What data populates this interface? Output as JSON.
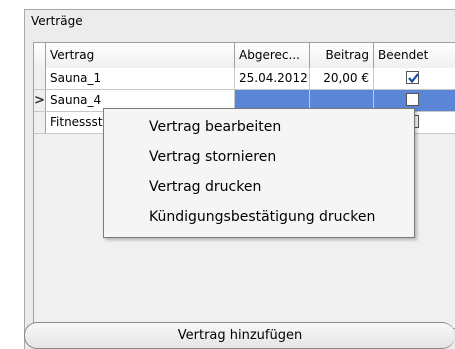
{
  "group": {
    "title": "Verträge"
  },
  "grid": {
    "columns": [
      "Vertrag",
      "Abgerec...",
      "Beitrag",
      "Beendet"
    ],
    "current_row_marker": ">",
    "rows": [
      {
        "vertrag": "Sauna_1",
        "abgerechnet": "25.04.2012",
        "beitrag": "20,00 €",
        "beendet": true
      },
      {
        "vertrag": "Sauna_4",
        "abgerechnet": "",
        "beitrag": "",
        "beendet": false,
        "selected": true
      },
      {
        "vertrag": "Fitnessst",
        "abgerechnet": "",
        "beitrag": "",
        "beendet": false
      }
    ]
  },
  "context_menu": {
    "items": [
      "Vertrag bearbeiten",
      "Vertrag stornieren",
      "Vertrag drucken",
      "Kündigungsbestätigung drucken"
    ]
  },
  "add_button": {
    "label": "Vertrag hinzufügen"
  },
  "colors": {
    "selection": "#5b86d6",
    "check": "#1a4fa0"
  }
}
